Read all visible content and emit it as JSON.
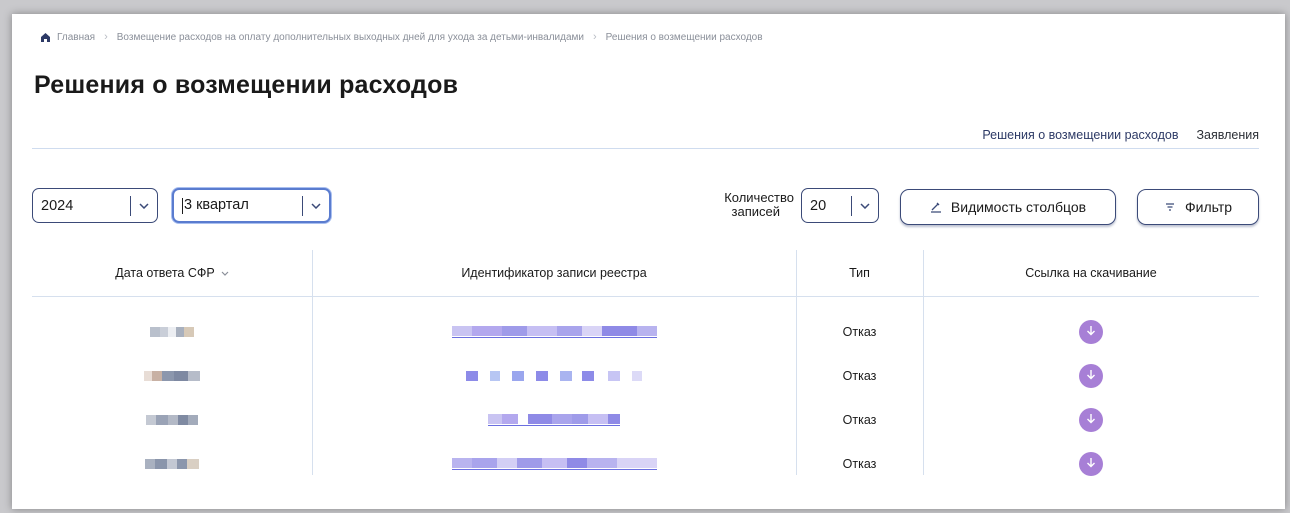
{
  "breadcrumb": {
    "home": "Главная",
    "section": "Возмещение расходов на оплату дополнительных выходных дней для ухода за детьми-инвалидами",
    "current": "Решения о возмещении расходов"
  },
  "page": {
    "title": "Решения о возмещении расходов"
  },
  "tabs": [
    {
      "label": "Решения о возмещении расходов",
      "active": true
    },
    {
      "label": "Заявления",
      "active": false
    }
  ],
  "filters": {
    "year": "2024",
    "quarter": "3 квартал",
    "records_label_line1": "Количество",
    "records_label_line2": "записей",
    "records_count": "20",
    "columns_visibility_button": "Видимость столбцов",
    "filter_button": "Фильтр"
  },
  "table": {
    "headers": {
      "date": "Дата ответа СФР",
      "registry_id": "Идентификатор записи реестра",
      "type": "Тип",
      "download": "Ссылка на скачивание"
    },
    "rows": [
      {
        "type": "Отказ"
      },
      {
        "type": "Отказ"
      },
      {
        "type": "Отказ"
      },
      {
        "type": "Отказ"
      }
    ]
  },
  "colors": {
    "accent": "#3b4a78",
    "download_button": "#a77fd6",
    "divider": "#cfdcef",
    "link": "#6b6fe0"
  },
  "icons": {
    "home": "home-icon",
    "chevron": "chevron-down-icon",
    "pencil": "pencil-icon",
    "filter": "filter-icon",
    "download": "download-arrow-icon"
  }
}
